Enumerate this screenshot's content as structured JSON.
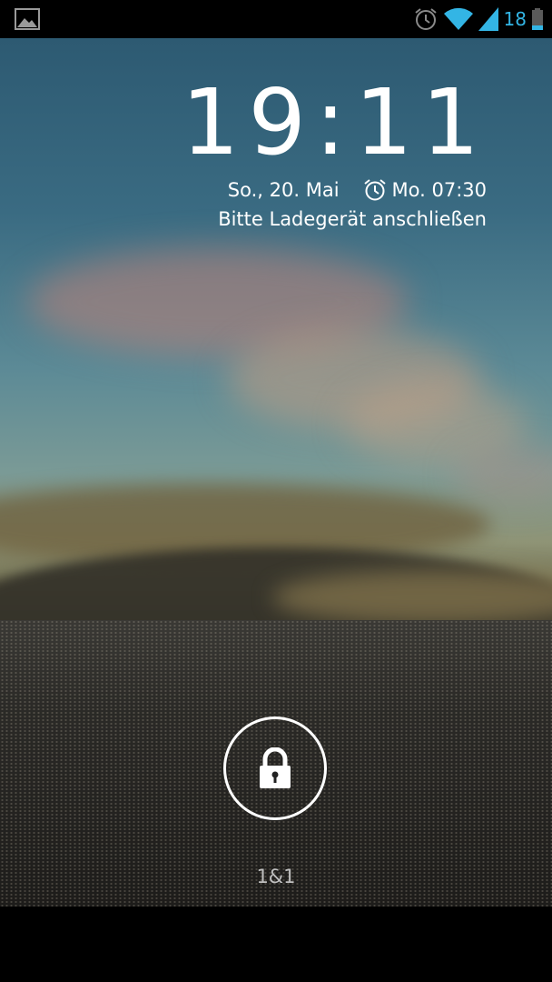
{
  "status_bar": {
    "battery_level": "18",
    "icons": [
      "gallery-icon",
      "alarm-icon",
      "wifi-icon",
      "signal-icon",
      "battery-icon"
    ],
    "accent_color": "#33b5e5"
  },
  "lockscreen": {
    "time": "19:11",
    "date": "So., 20. Mai",
    "alarm": "Mo. 07:30",
    "charge_message": "Bitte Ladegerät anschließen",
    "carrier": "1&1",
    "lock_icon": "padlock-icon"
  }
}
